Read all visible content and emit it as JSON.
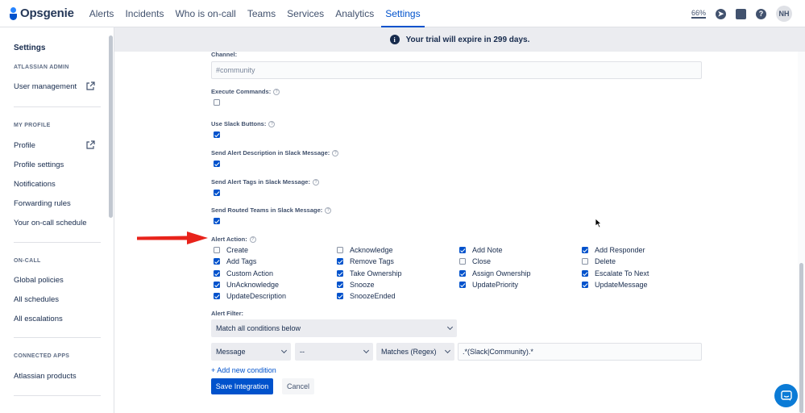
{
  "nav": {
    "brand": "Opsgenie",
    "items": [
      "Alerts",
      "Incidents",
      "Who is on-call",
      "Teams",
      "Services",
      "Analytics",
      "Settings"
    ],
    "zoom": "66%",
    "avatar": "NH"
  },
  "sidebar": {
    "title": "Settings",
    "sections": [
      "ATLASSIAN ADMIN",
      "MY PROFILE",
      "ON-CALL",
      "CONNECTED APPS"
    ],
    "admin_items": [
      "User management"
    ],
    "profile_items": [
      "Profile",
      "Profile settings",
      "Notifications",
      "Forwarding rules",
      "Your on-call schedule"
    ],
    "oncall_items": [
      "Global policies",
      "All schedules",
      "All escalations"
    ],
    "apps_items": [
      "Atlassian products"
    ]
  },
  "banner": {
    "text": "Your trial will expire in 299 days."
  },
  "form": {
    "channel_label": "Channel:",
    "channel_placeholder": "#community",
    "execute_commands_label": "Execute Commands:",
    "execute_commands": false,
    "slack_buttons_label": "Use Slack Buttons:",
    "slack_buttons": true,
    "alert_desc_label": "Send Alert Description in Slack Message:",
    "alert_desc": true,
    "alert_tags_label": "Send Alert Tags in Slack Message:",
    "alert_tags": true,
    "routed_teams_label": "Send Routed Teams in Slack Message:",
    "routed_teams": true,
    "alert_action_label": "Alert Action:",
    "alert_actions": [
      {
        "label": "Create",
        "checked": false
      },
      {
        "label": "Acknowledge",
        "checked": false
      },
      {
        "label": "Add Note",
        "checked": true
      },
      {
        "label": "Add Responder",
        "checked": true
      },
      {
        "label": "Add Tags",
        "checked": true
      },
      {
        "label": "Remove Tags",
        "checked": true
      },
      {
        "label": "Close",
        "checked": false
      },
      {
        "label": "Delete",
        "checked": false
      },
      {
        "label": "Custom Action",
        "checked": true
      },
      {
        "label": "Take Ownership",
        "checked": true
      },
      {
        "label": "Assign Ownership",
        "checked": true
      },
      {
        "label": "Escalate To Next",
        "checked": true
      },
      {
        "label": "UnAcknowledge",
        "checked": true
      },
      {
        "label": "Snooze",
        "checked": true
      },
      {
        "label": "UpdatePriority",
        "checked": true
      },
      {
        "label": "UpdateMessage",
        "checked": true
      },
      {
        "label": "UpdateDescription",
        "checked": true
      },
      {
        "label": "SnoozeEnded",
        "checked": true
      }
    ],
    "alert_filter_label": "Alert Filter:",
    "filter_mode": "Match all conditions below",
    "condition": {
      "field": "Message",
      "negate": "--",
      "operation": "Matches (Regex)",
      "value": ".*(Slack|Community).*"
    },
    "add_condition": "+ Add new condition",
    "save_label": "Save Integration",
    "cancel_label": "Cancel"
  },
  "colors": {
    "primary": "#0052cc",
    "annotation_arrow": "#e8231b",
    "banner_bg": "#ebecf0"
  }
}
